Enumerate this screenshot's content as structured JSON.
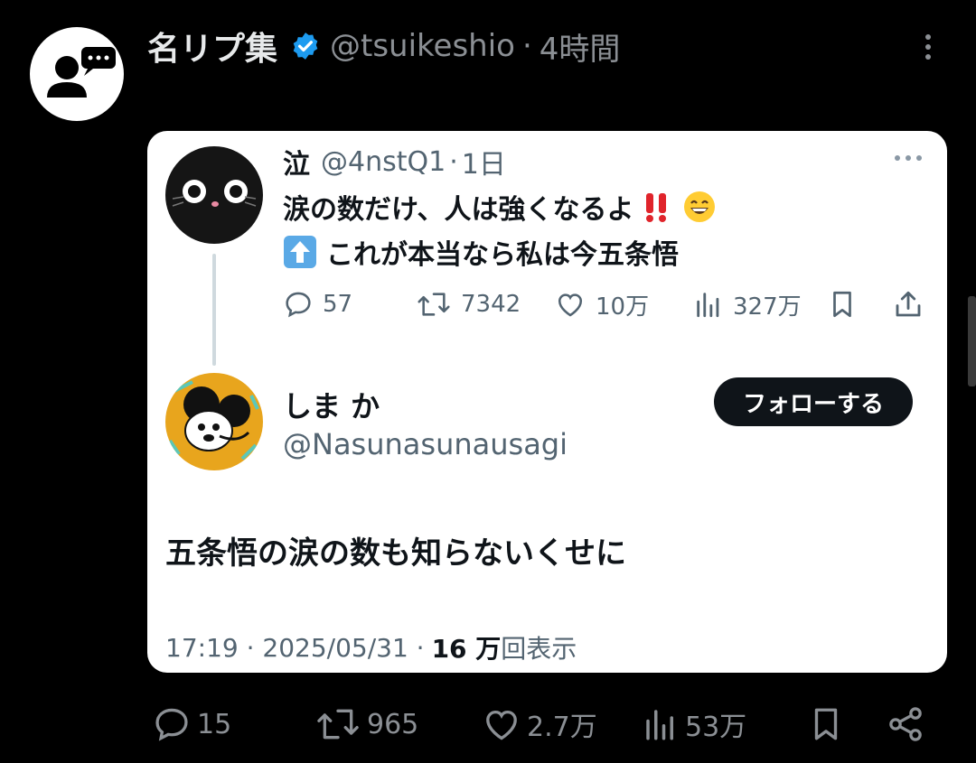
{
  "tweet": {
    "author_name": "名リプ集",
    "handle": "@tsuikeshio",
    "separator": "·",
    "time": "4時間"
  },
  "card": {
    "original": {
      "name": "泣",
      "handle": "@4nstQ1",
      "separator": "·",
      "time": "1日",
      "line1": "涙の数だけ、人は強くなるよ",
      "line1_emojis": [
        "double-exclamation-emoji",
        "grinning-face-emoji"
      ],
      "line2": "これが本当なら私は今五条悟",
      "line2_emoji": "up-arrow-emoji",
      "actions": {
        "replies": "57",
        "retweets": "7342",
        "likes": "10万",
        "views": "327万"
      }
    },
    "reply": {
      "name": "しま か",
      "handle": "@Nasunasunausagi",
      "follow_label": "フォローする",
      "text": "五条悟の涙の数も知らないくせに",
      "timestamp": "17:19 · 2025/05/31 ·",
      "views_count": "16 万",
      "views_label": "回表示"
    }
  },
  "actions": {
    "replies": "15",
    "retweets": "965",
    "likes": "2.7万",
    "views": "53万"
  },
  "colors": {
    "background": "#000000",
    "card": "#ffffff",
    "verified": "#1d9bf0",
    "muted": "#8b8f94",
    "follow_button": "#0f1419"
  }
}
